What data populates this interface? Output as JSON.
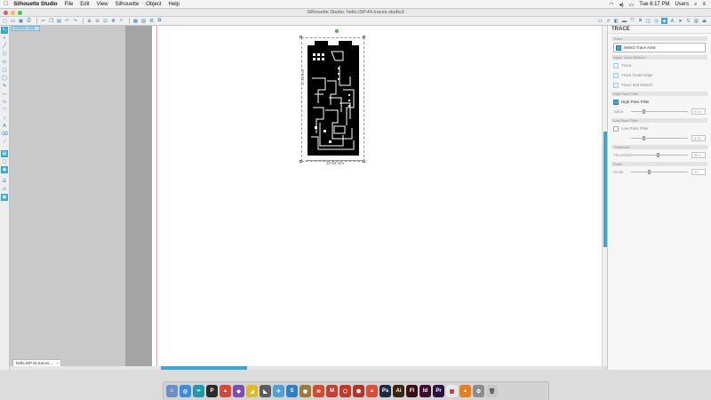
{
  "menubar": {
    "apple": "",
    "items": [
      "Silhouette Studio",
      "File",
      "Edit",
      "View",
      "Silhouette",
      "Object",
      "Help"
    ],
    "clock": "Tue 6:17 PM",
    "user": "Users"
  },
  "window": {
    "title": "Silhouette Studio: hello.ISP.44.traces.studio3"
  },
  "canvas": {
    "design_tag": "DESIGN VIEW",
    "doc_tab": "hello.ISP.44.traces....",
    "dim_width": "22.83 mm",
    "dim_height": "47.88 mm"
  },
  "panel": {
    "title": "TRACE",
    "section_trace": "Trace",
    "select_area_label": "Select Trace Area",
    "section_method": "Apply Trace Method",
    "method_trace": "Trace",
    "method_outer": "Trace Outer Edge",
    "method_detach": "Trace and Detach",
    "section_high_pass": "High Pass Filter",
    "high_pass_label": "High Pass Filter",
    "high_pass_value_label": "Value",
    "high_pass_value": "5.00",
    "section_low_pass": "Low Pass Filter",
    "low_pass_label": "Low Pass Filter",
    "low_pass_value": "5.00",
    "section_threshold": "Threshold",
    "threshold_label": "Threshold",
    "threshold_value": "45.0",
    "section_scale": "Scale",
    "scale_label": "Scale",
    "scale_value": "10"
  },
  "colors": {
    "accent": "#3aa6d8",
    "pcb": "#000000"
  }
}
